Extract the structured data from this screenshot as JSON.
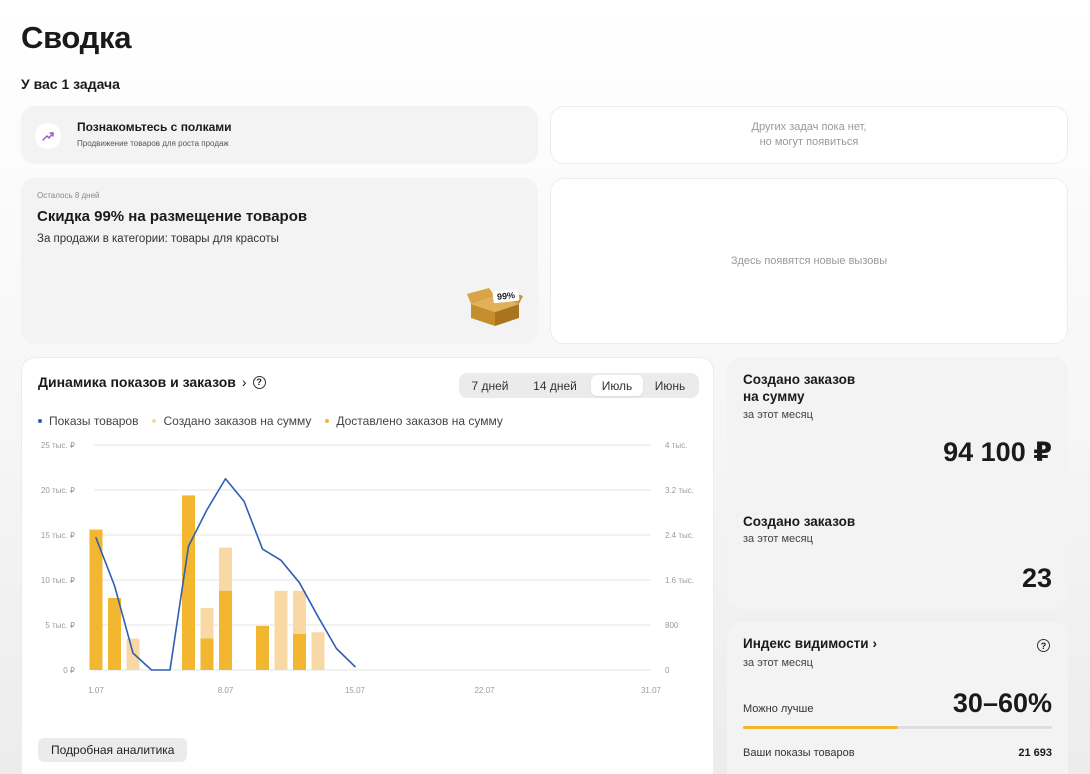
{
  "page": {
    "title": "Сводка",
    "tasks_count": "У вас 1 задача"
  },
  "task": {
    "icon": "trend-up-icon",
    "title": "Познакомьтесь с полками",
    "subtitle": "Продвижение товаров для роста продаж"
  },
  "other_tasks": {
    "line1": "Других задач пока нет,",
    "line2": "но могут появиться"
  },
  "promo": {
    "days_left": "Осталось 8 дней",
    "title": "Скидка 99% на размещение товаров",
    "subtitle": "За продажи в категории: товары для красоты",
    "badge": "99%",
    "image_icon": "open-box-icon"
  },
  "challenges": {
    "text": "Здесь появятся новые вызовы"
  },
  "chart_card": {
    "title": "Динамика показов и заказов",
    "chevron": "›",
    "help": "?",
    "tabs": [
      {
        "label": "7 дней",
        "active": false
      },
      {
        "label": "14 дней",
        "active": false
      },
      {
        "label": "Июль",
        "active": true
      },
      {
        "label": "Июнь",
        "active": false
      }
    ],
    "analytics_button": "Подробная аналитика"
  },
  "chart_data": {
    "type": "bar",
    "x": [
      1,
      2,
      3,
      4,
      5,
      6,
      7,
      8,
      9,
      10,
      11,
      12,
      13,
      14,
      15,
      16,
      17,
      18,
      19,
      20,
      21,
      22,
      23,
      24,
      25,
      26,
      27,
      28,
      29,
      30,
      31
    ],
    "x_tick_labels": [
      "1.07",
      "8.07",
      "15.07",
      "22.07",
      "31.07"
    ],
    "x_tick_days": [
      1,
      8,
      15,
      22,
      31
    ],
    "y_left_ticks": [
      "0 ₽",
      "5 тыс. ₽",
      "10 тыс. ₽",
      "15 тыс. ₽",
      "20 тыс. ₽",
      "25 тыс. ₽"
    ],
    "y_left_lim": [
      0,
      25000
    ],
    "y_right_ticks": [
      "0",
      "800",
      "1.6 тыс.",
      "2.4 тыс.",
      "3.2 тыс.",
      "4 тыс."
    ],
    "y_right_lim": [
      0,
      4000
    ],
    "grid": true,
    "legend_position": "top-left",
    "series": [
      {
        "name": "Показы товаров",
        "kind": "line",
        "axis": "right",
        "color": "#2f5fb3",
        "points": [
          [
            1,
            2350
          ],
          [
            2,
            1500
          ],
          [
            3,
            300
          ],
          [
            4,
            0
          ],
          [
            5,
            0
          ],
          [
            6,
            2200
          ],
          [
            7,
            2850
          ],
          [
            8,
            3400
          ],
          [
            9,
            3000
          ],
          [
            10,
            2150
          ],
          [
            11,
            1950
          ],
          [
            12,
            1550
          ],
          [
            13,
            950
          ],
          [
            14,
            380
          ],
          [
            15,
            60
          ]
        ]
      },
      {
        "name": "Создано заказов на сумму",
        "kind": "bar",
        "axis": "left",
        "color": "#f8d9a6",
        "points": [
          [
            3,
            3500
          ],
          [
            7,
            6900
          ],
          [
            8,
            13600
          ],
          [
            11,
            8800
          ],
          [
            12,
            8800
          ],
          [
            13,
            4200
          ]
        ]
      },
      {
        "name": "Доставлено заказов на сумму",
        "kind": "bar",
        "axis": "left",
        "color": "#f2b631",
        "points": [
          [
            1,
            15600
          ],
          [
            2,
            8000
          ],
          [
            6,
            19400
          ],
          [
            7,
            3500
          ],
          [
            8,
            8800
          ],
          [
            10,
            4900
          ],
          [
            12,
            4000
          ]
        ]
      }
    ]
  },
  "stats": {
    "orders_sum": {
      "title_line1": "Создано заказов",
      "title_line2": "на сумму",
      "period": "за этот месяц",
      "value": "94 100 ₽"
    },
    "orders_count": {
      "title": "Создано заказов",
      "period": "за этот месяц",
      "value": "23"
    },
    "visibility": {
      "title": "Индекс видимости",
      "chevron": "›",
      "help": "?",
      "period": "за этот месяц",
      "label": "Можно лучше",
      "value": "30–60%",
      "progress": 0.5,
      "shows_label": "Ваши показы товаров",
      "shows_value": "21 693"
    }
  }
}
